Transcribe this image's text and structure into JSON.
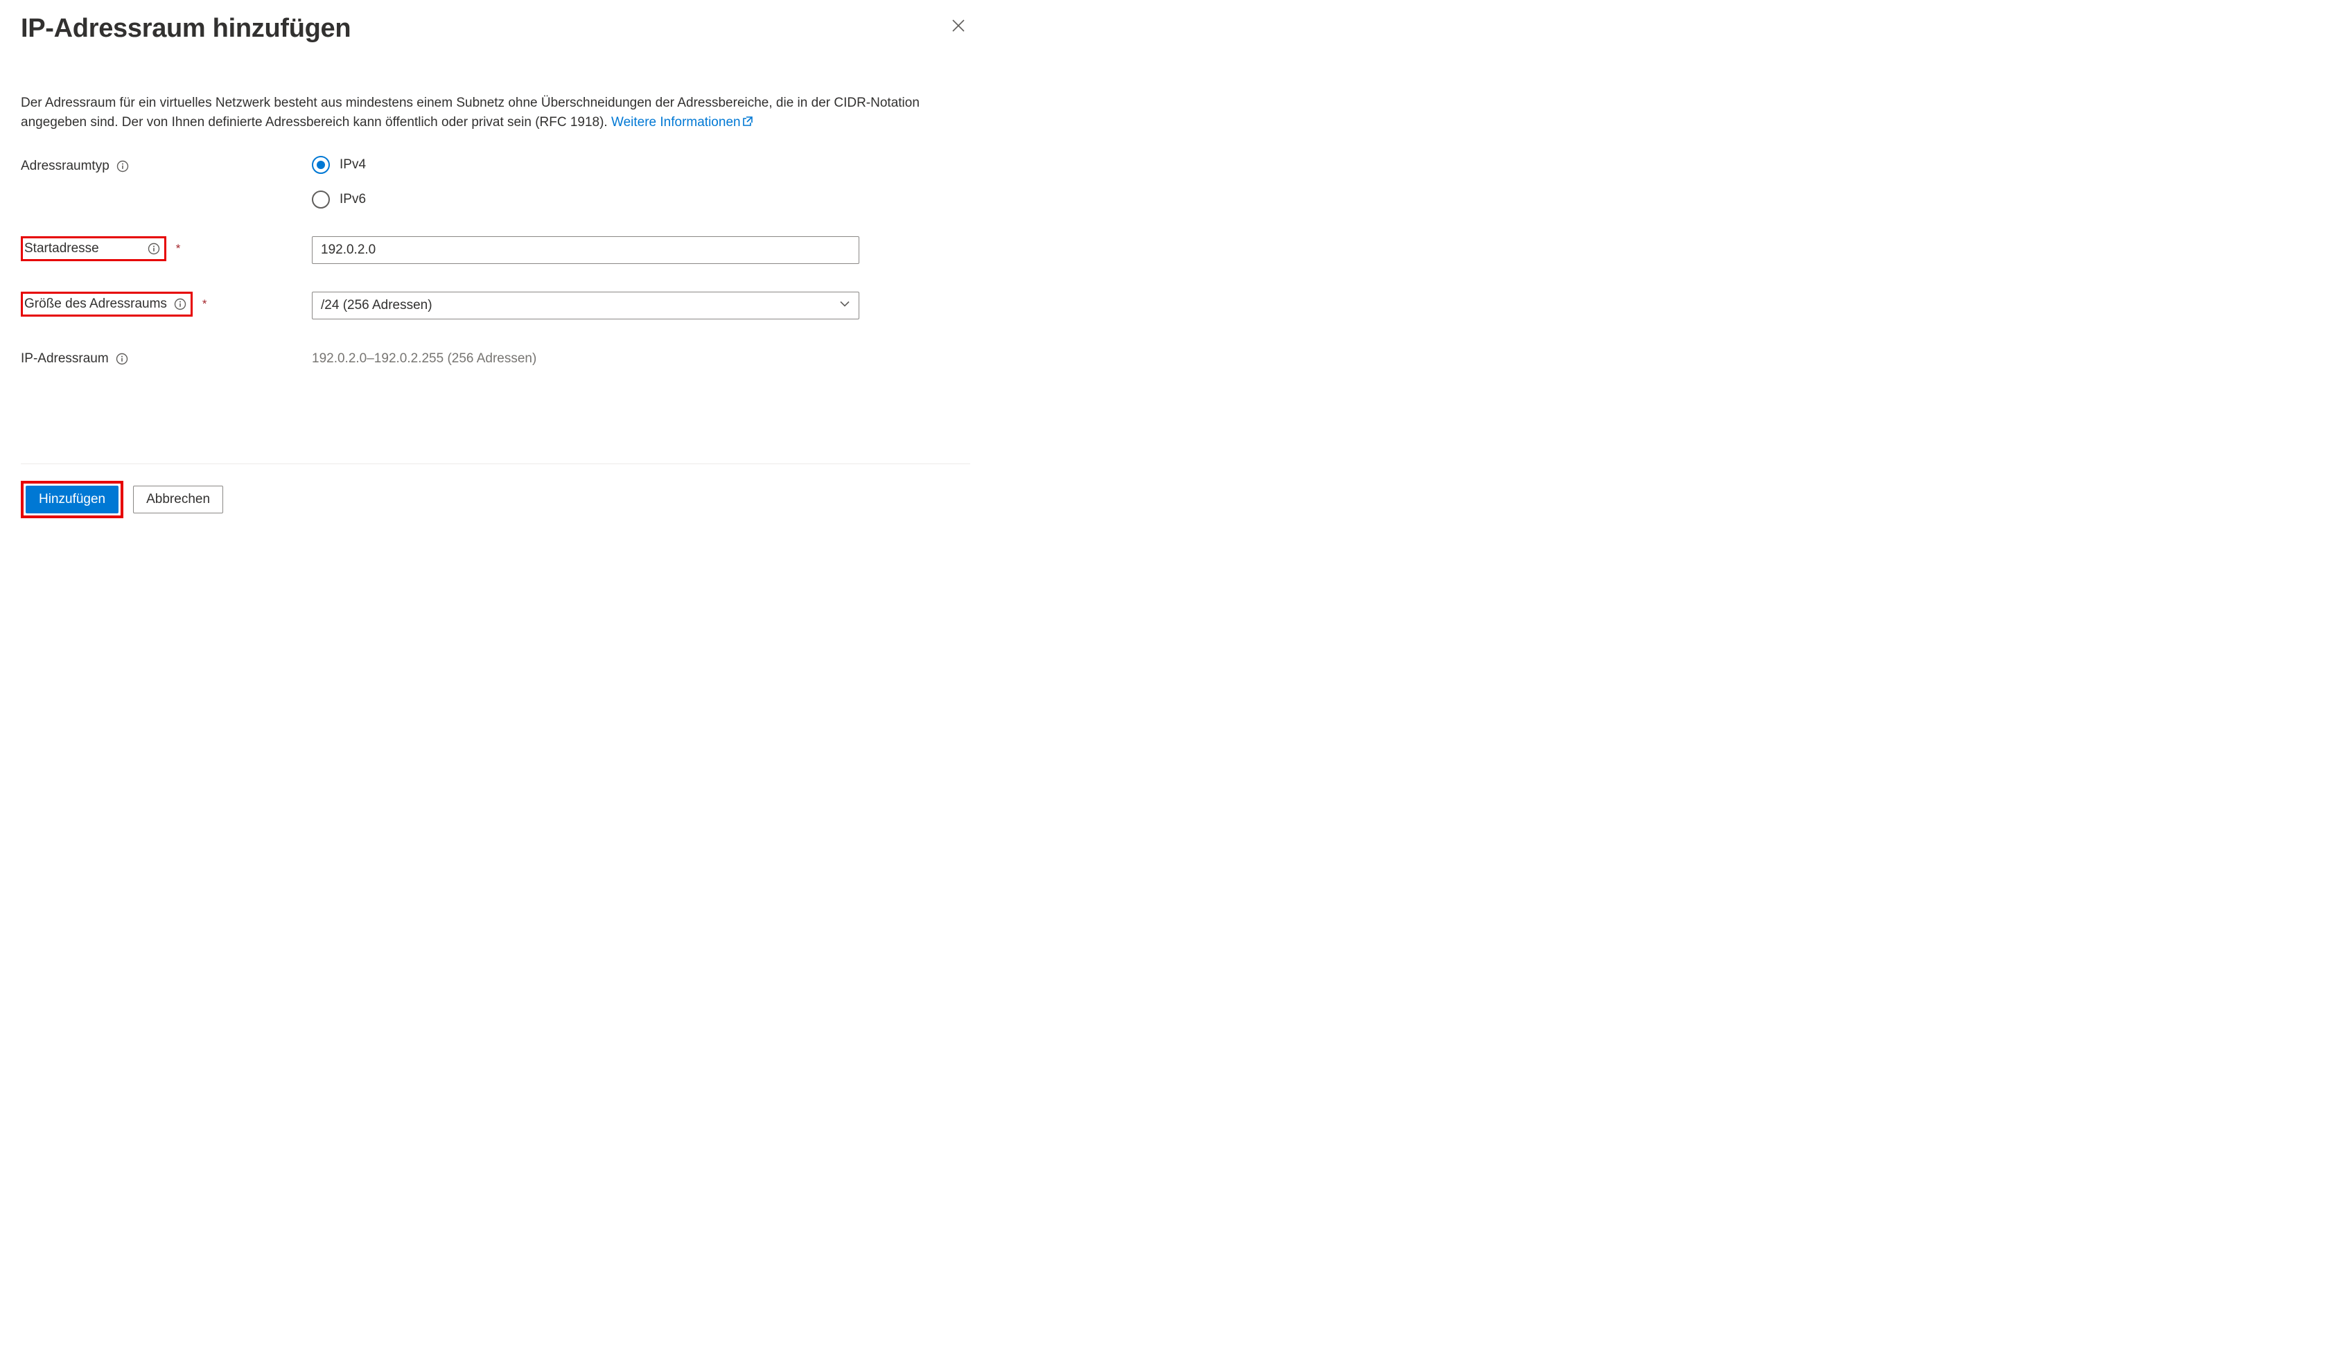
{
  "header": {
    "title": "IP-Adressraum hinzufügen"
  },
  "description": {
    "text_before_link": "Der Adressraum für ein virtuelles Netzwerk besteht aus mindestens einem Subnetz ohne Überschneidungen der Adressbereiche, die in der CIDR-Notation angegeben sind. Der von Ihnen definierte Adressbereich kann öffentlich oder privat sein (RFC 1918). ",
    "link_text": "Weitere Informationen"
  },
  "fields": {
    "address_type": {
      "label": "Adressraumtyp",
      "options": {
        "ipv4": "IPv4",
        "ipv6": "IPv6"
      },
      "selected": "ipv4"
    },
    "start_address": {
      "label": "Startadresse",
      "value": "192.0.2.0"
    },
    "size": {
      "label": "Größe des Adressraums",
      "value": "/24 (256 Adressen)"
    },
    "ip_space": {
      "label": "IP-Adressraum",
      "value": "192.0.2.0–192.0.2.255 (256 Adressen)"
    }
  },
  "footer": {
    "add": "Hinzufügen",
    "cancel": "Abbrechen"
  }
}
